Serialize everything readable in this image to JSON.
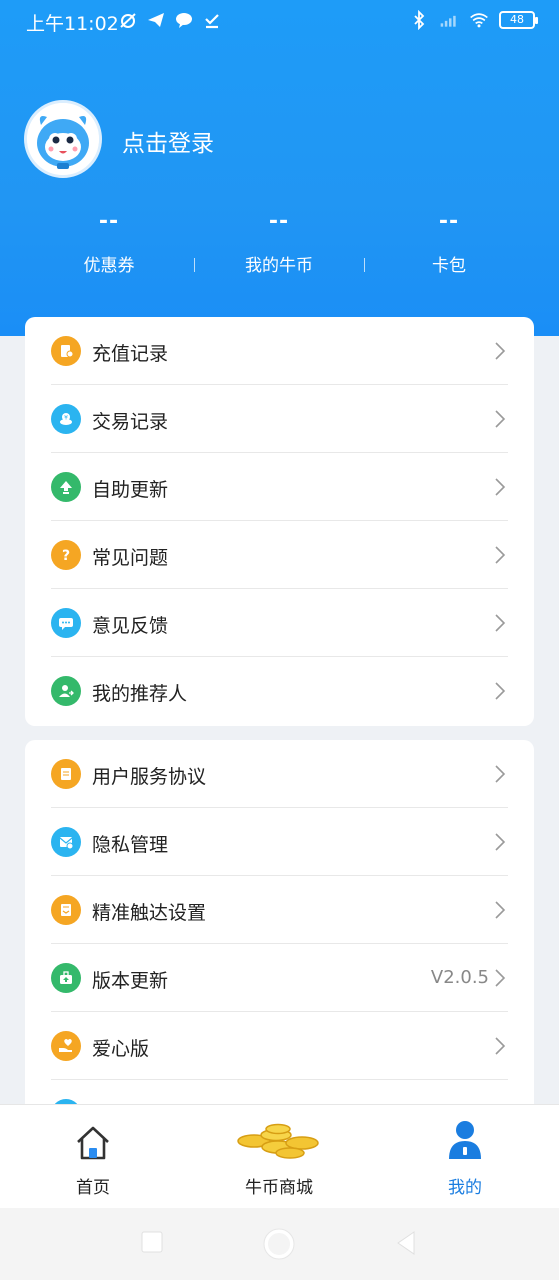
{
  "status_bar": {
    "time": "上午11:02",
    "battery": "48"
  },
  "profile": {
    "login_text": "点击登录"
  },
  "stats": [
    {
      "value": "--",
      "label": "优惠券"
    },
    {
      "value": "--",
      "label": "我的牛币"
    },
    {
      "value": "--",
      "label": "卡包"
    }
  ],
  "menu_group_1": [
    {
      "label": "充值记录",
      "icon": "recharge-record-icon",
      "color": "#f5a623"
    },
    {
      "label": "交易记录",
      "icon": "transaction-record-icon",
      "color": "#2bb4f0"
    },
    {
      "label": "自助更新",
      "icon": "self-update-icon",
      "color": "#34b96b"
    },
    {
      "label": "常见问题",
      "icon": "question-icon",
      "color": "#f5a623"
    },
    {
      "label": "意见反馈",
      "icon": "feedback-icon",
      "color": "#2bb4f0"
    },
    {
      "label": "我的推荐人",
      "icon": "referrer-icon",
      "color": "#34b96b"
    }
  ],
  "menu_group_2": [
    {
      "label": "用户服务协议",
      "icon": "agreement-icon",
      "color": "#f5a623"
    },
    {
      "label": "隐私管理",
      "icon": "privacy-icon",
      "color": "#2bb4f0"
    },
    {
      "label": "精准触达设置",
      "icon": "reach-settings-icon",
      "color": "#f5a623"
    },
    {
      "label": "版本更新",
      "icon": "version-update-icon",
      "color": "#34b96b",
      "value": "V2.0.5"
    },
    {
      "label": "爱心版",
      "icon": "care-version-icon",
      "color": "#f5a623"
    }
  ],
  "tabs": [
    {
      "label": "首页",
      "icon": "home-icon"
    },
    {
      "label": "牛币商城",
      "icon": "coins-icon"
    },
    {
      "label": "我的",
      "icon": "user-icon"
    }
  ],
  "colors": {
    "header_blue": "#1e9cf8",
    "active_tab": "#1a7de0"
  }
}
